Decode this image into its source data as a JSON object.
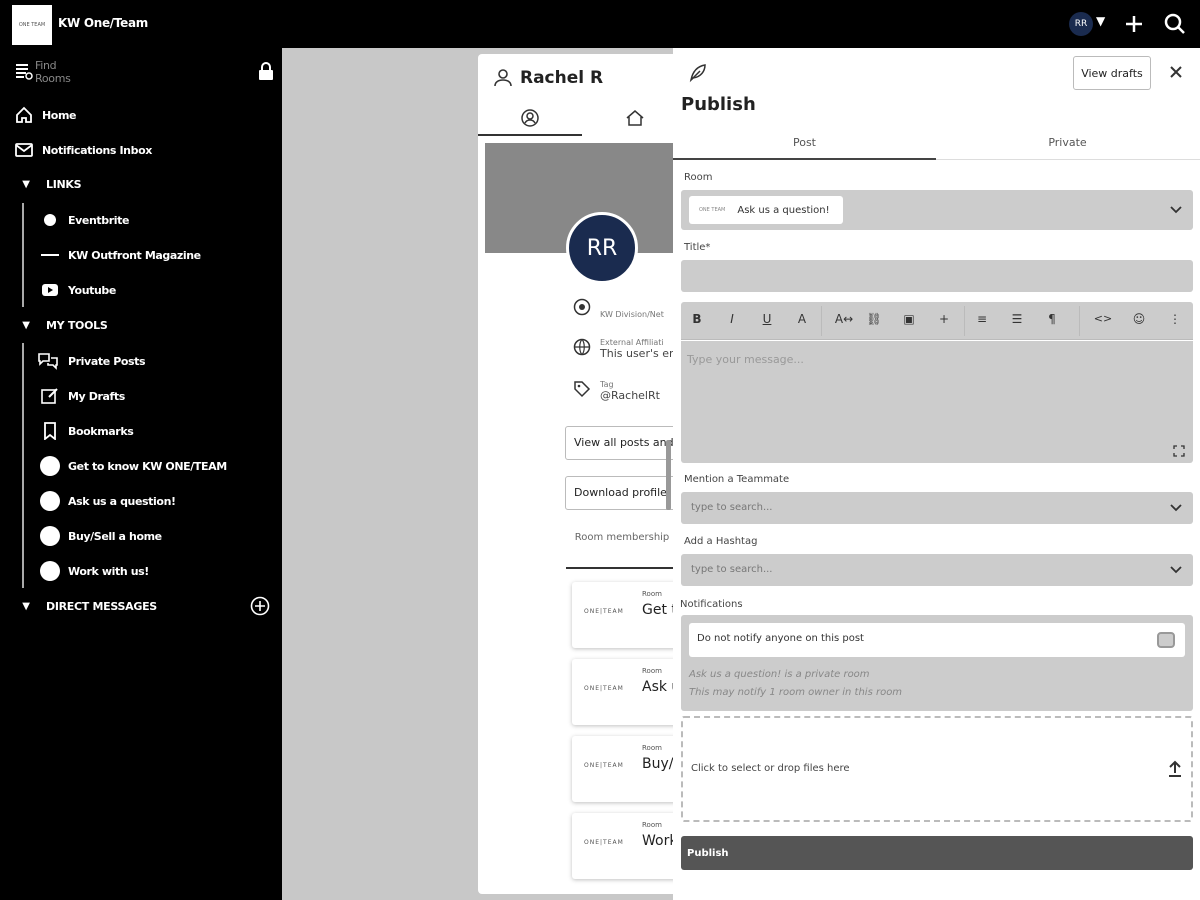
{
  "app": {
    "logo_text": "ONE TEAM",
    "title": "KW One/Team",
    "user_initials": "RR",
    "caret": "▼"
  },
  "sidebar": {
    "find_rooms": "Find Rooms",
    "home": "Home",
    "notifications": "Notifications Inbox",
    "links_heading": "LINKS",
    "links": [
      "Eventbrite",
      "KW Outfront Magazine",
      "Youtube"
    ],
    "tools_heading": "MY TOOLS",
    "tools": [
      "Private Posts",
      "My Drafts",
      "Bookmarks",
      "Get to know KW ONE/TEAM",
      "Ask us a question!",
      "Buy/Sell a home",
      "Work with us!"
    ],
    "dm_heading": "DIRECT MESSAGES"
  },
  "profile": {
    "name": "Rachel R",
    "avatar": "RR",
    "division_label": "KW Division/Net",
    "affiliation_label": "External Affiliati",
    "affiliation_value": "This user's em",
    "tag_label": "Tag",
    "tag_value": "@RachelRt",
    "view_posts_button": "View all posts and",
    "download_button": "Download profile",
    "room_membership": "Room membership",
    "room_card_label": "Room",
    "room_logo": "ONE|TEAM",
    "rooms": [
      "Get t",
      "Ask u",
      "Buy/",
      "Work"
    ]
  },
  "publish": {
    "title": "Publish",
    "view_drafts": "View drafts",
    "tabs": [
      "Post",
      "Private"
    ],
    "room_label": "Room",
    "room_chip_logo": "ONE TEAM",
    "room_value": "Ask us a question!",
    "title_label": "Title*",
    "editor_placeholder": "Type your message...",
    "toolbar": [
      "B",
      "I",
      "U",
      "A",
      "A↔",
      "⛓",
      "▣",
      "+",
      "≡",
      "☰",
      "¶",
      "<>",
      "☺",
      "⋮"
    ],
    "mention_label": "Mention a Teammate",
    "mention_placeholder": "type to search...",
    "hashtag_label": "Add a Hashtag",
    "hashtag_placeholder": "type to search...",
    "notifications_label": "Notifications",
    "notify_option": "Do not notify anyone on this post",
    "notify_note_1": "Ask us a question! is a private room",
    "notify_note_2": "This may notify 1 room owner in this room",
    "drop_text": "Click to select or drop files here",
    "publish_button": "Publish"
  }
}
